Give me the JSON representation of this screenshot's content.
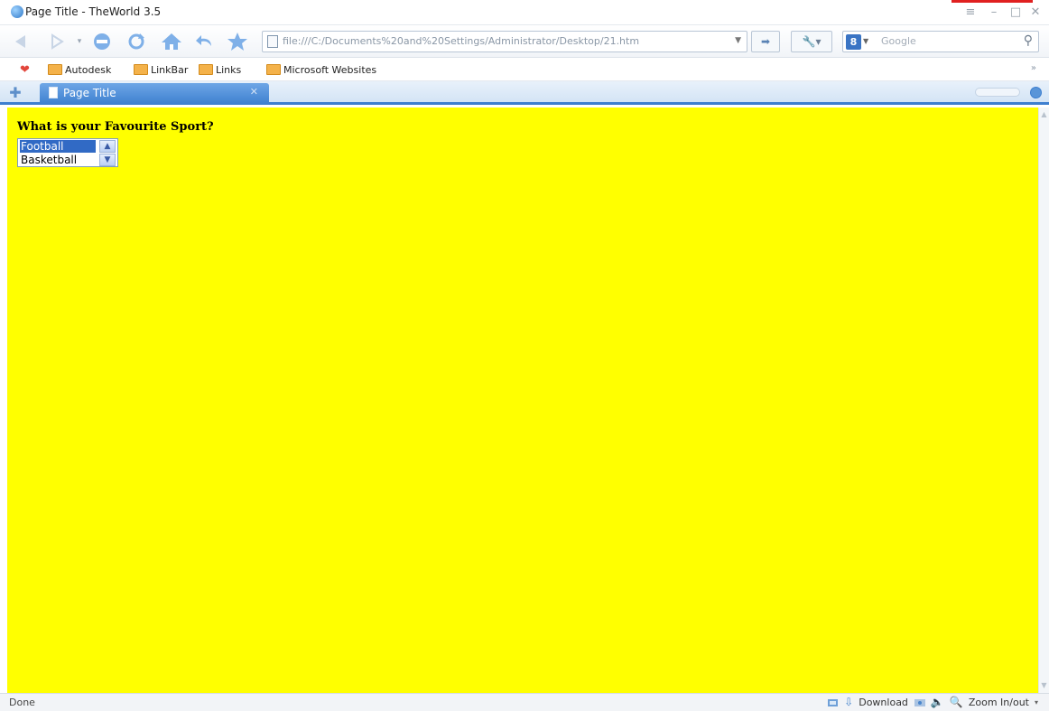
{
  "window": {
    "title": "Page Title - TheWorld 3.5",
    "controls": [
      "menu",
      "minimize",
      "maximize",
      "close"
    ]
  },
  "address_bar": {
    "url": "file:///C:/Documents%20and%20Settings/Administrator/Desktop/21.htm"
  },
  "search": {
    "engine": "8",
    "placeholder": "Google"
  },
  "links_bar": {
    "items": [
      {
        "label": "Autodesk"
      },
      {
        "label": "LinkBar"
      },
      {
        "label": "Links"
      },
      {
        "label": "Microsoft Websites"
      }
    ],
    "more": "»"
  },
  "tabs": [
    {
      "label": "Page Title"
    }
  ],
  "content": {
    "question": "What is your Favourite Sport?",
    "select": {
      "options": [
        {
          "label": "Football",
          "selected": true
        },
        {
          "label": "Basketball",
          "selected": false
        }
      ]
    },
    "background": "#ffff00"
  },
  "status": {
    "text": "Done",
    "download": "Download",
    "zoom": "Zoom In/out"
  },
  "colors": {
    "accent": "#3d7fcf",
    "selection": "#316ac5"
  }
}
